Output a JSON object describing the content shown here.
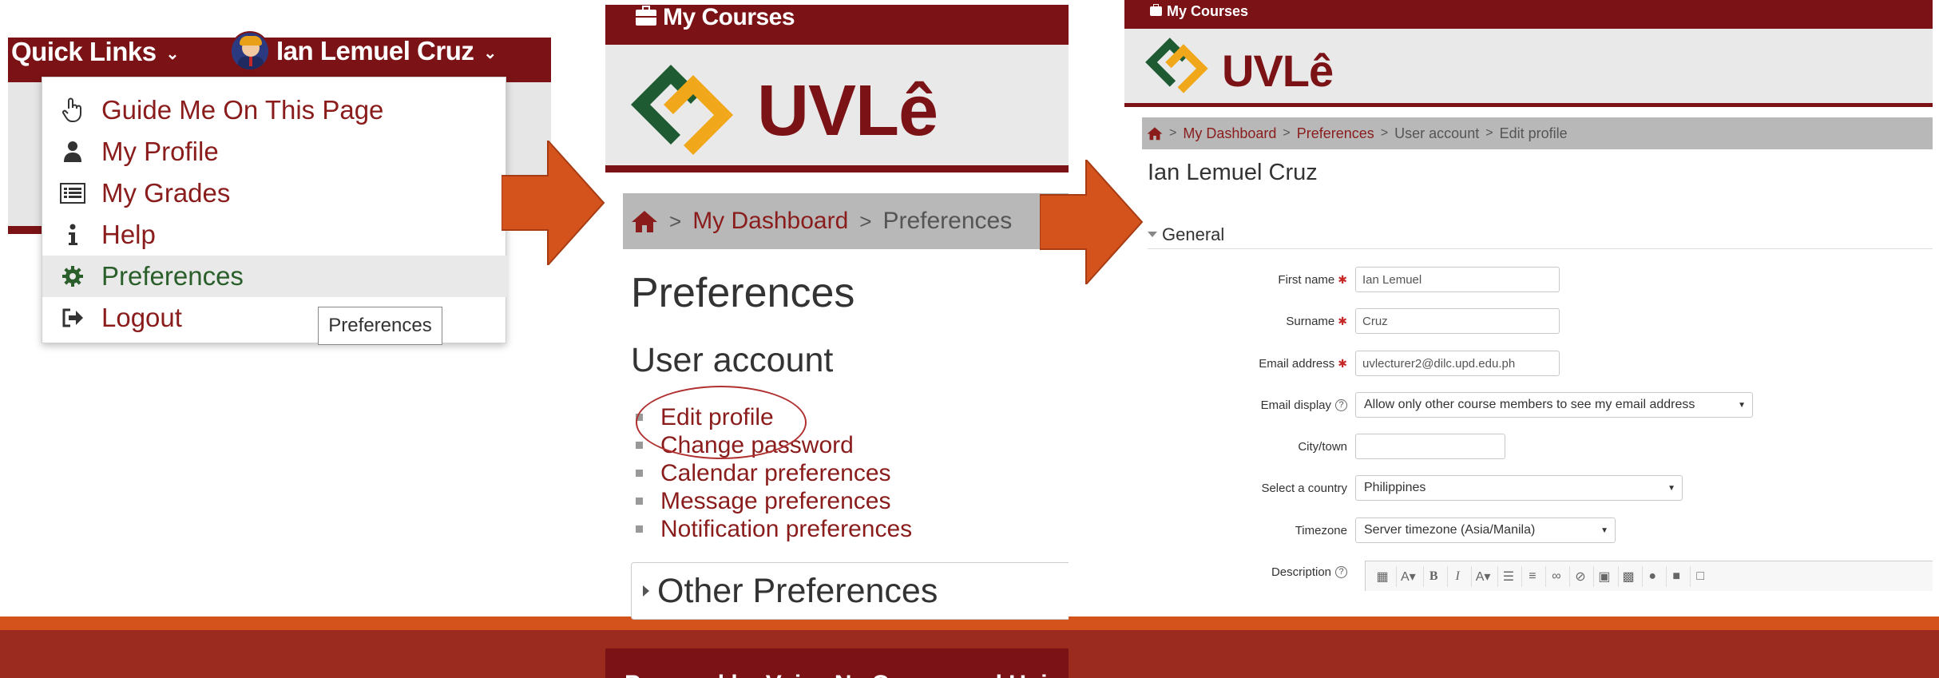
{
  "panel1": {
    "quick_links": "Quick Links",
    "user_name": "Ian Lemuel Cruz",
    "menu": [
      {
        "label": "Guide Me On This Page",
        "icon": "hand-pointer-icon"
      },
      {
        "label": "My Profile",
        "icon": "user-icon"
      },
      {
        "label": "My Grades",
        "icon": "grades-table-icon"
      },
      {
        "label": "Help",
        "icon": "info-icon"
      },
      {
        "label": "Preferences",
        "icon": "gear-icon"
      },
      {
        "label": "Logout",
        "icon": "logout-icon"
      }
    ],
    "tooltip": "Preferences"
  },
  "panel2": {
    "my_courses": "My Courses",
    "logo": "UVLê",
    "breadcrumb": {
      "dashboard": "My Dashboard",
      "current": "Preferences"
    },
    "title": "Preferences",
    "section": "User account",
    "links": [
      "Edit profile",
      "Change password",
      "Calendar preferences",
      "Message preferences",
      "Notification preferences"
    ],
    "other": "Other Preferences",
    "footer": "Powered by Voice Ne Core ... and Uni"
  },
  "panel3": {
    "my_courses": "My Courses",
    "logo": "UVLê",
    "breadcrumb": {
      "dashboard": "My Dashboard",
      "preferences": "Preferences",
      "user_account": "User account",
      "current": "Edit profile"
    },
    "name": "Ian Lemuel Cruz",
    "general": "General",
    "fields": {
      "first_name": {
        "label": "First name",
        "value": "Ian Lemuel"
      },
      "surname": {
        "label": "Surname",
        "value": "Cruz"
      },
      "email": {
        "label": "Email address",
        "value": "uvlecturer2@dilc.upd.edu.ph"
      },
      "email_display": {
        "label": "Email display",
        "value": "Allow only other course members to see my email address"
      },
      "city": {
        "label": "City/town",
        "value": ""
      },
      "country": {
        "label": "Select a country",
        "value": "Philippines"
      },
      "timezone": {
        "label": "Timezone",
        "value": "Server timezone (Asia/Manila)"
      },
      "description": {
        "label": "Description"
      }
    }
  },
  "colors": {
    "maroon": "#7b1316",
    "link": "#8a1c1c",
    "arrow": "#d4521c",
    "footer": "#9b2b1f"
  }
}
